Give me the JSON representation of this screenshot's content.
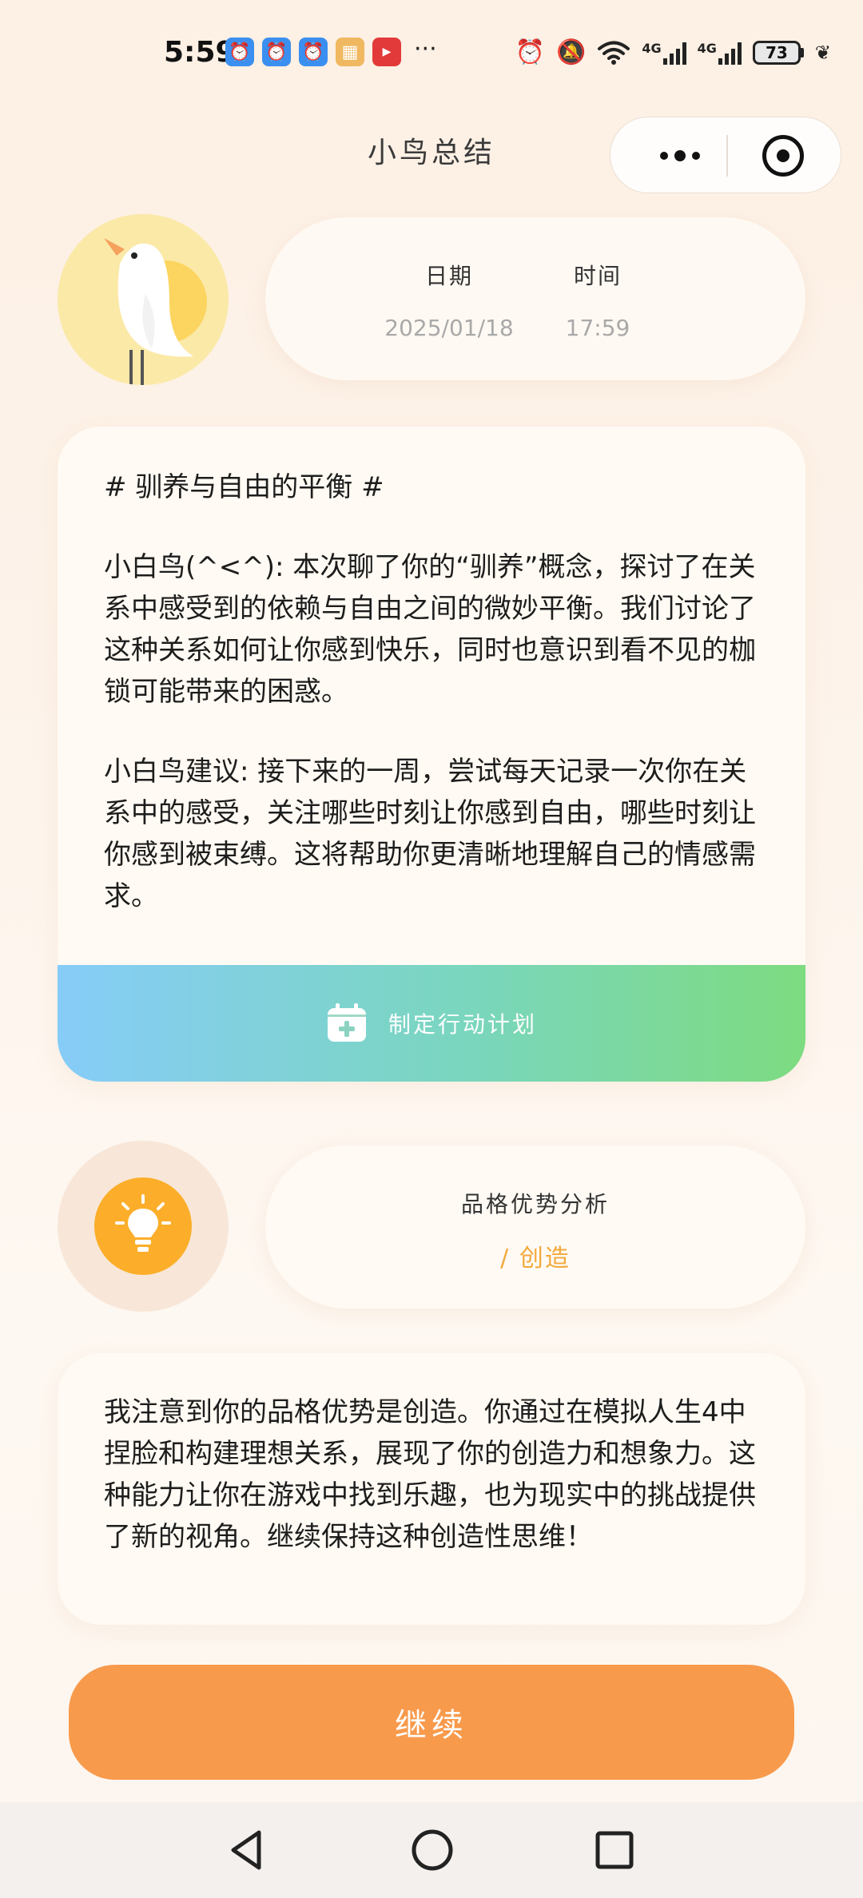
{
  "status_bar": {
    "time": "5:59",
    "more": "···",
    "battery": "73",
    "network_1": "4G",
    "network_2": "4G",
    "app_icons": [
      "clock-app-icon",
      "clock-app-icon",
      "clock-app-icon",
      "game-app-icon",
      "video-app-icon"
    ]
  },
  "header": {
    "title": "小鸟总结"
  },
  "info": {
    "date_label": "日期",
    "date_value": "2025/01/18",
    "time_label": "时间",
    "time_value": "17:59"
  },
  "summary": {
    "heading": "# 驯养与自由的平衡 #",
    "paragraph_1": "小白鸟(^<^): 本次聊了你的“驯养”概念，探讨了在关系中感受到的依赖与自由之间的微妙平衡。我们讨论了这种关系如何让你感到快乐，同时也意识到看不见的枷锁可能带来的困惑。",
    "paragraph_2": "小白鸟建议: 接下来的一周，尝试每天记录一次你在关系中的感受，关注哪些时刻让你感到自由，哪些时刻让你感到被束缚。这将帮助你更清晰地理解自己的情感需求。",
    "plan_button": "制定行动计划"
  },
  "strength": {
    "title": "品格优势分析",
    "value": "/ 创造",
    "description": "我注意到你的品格优势是创造。你通过在模拟人生4中捏脸和构建理想关系，展现了你的创造力和想象力。这种能力让你在游戏中找到乐趣，也为现实中的挑战提供了新的视角。继续保持这种创造性思维！"
  },
  "continue_button": "继续",
  "colors": {
    "accent_orange": "#f89a4c",
    "strength_text": "#f2a93b",
    "plan_gradient_start": "#86ccf8",
    "plan_gradient_end": "#7ddb80",
    "bulb": "#fcae2a"
  }
}
